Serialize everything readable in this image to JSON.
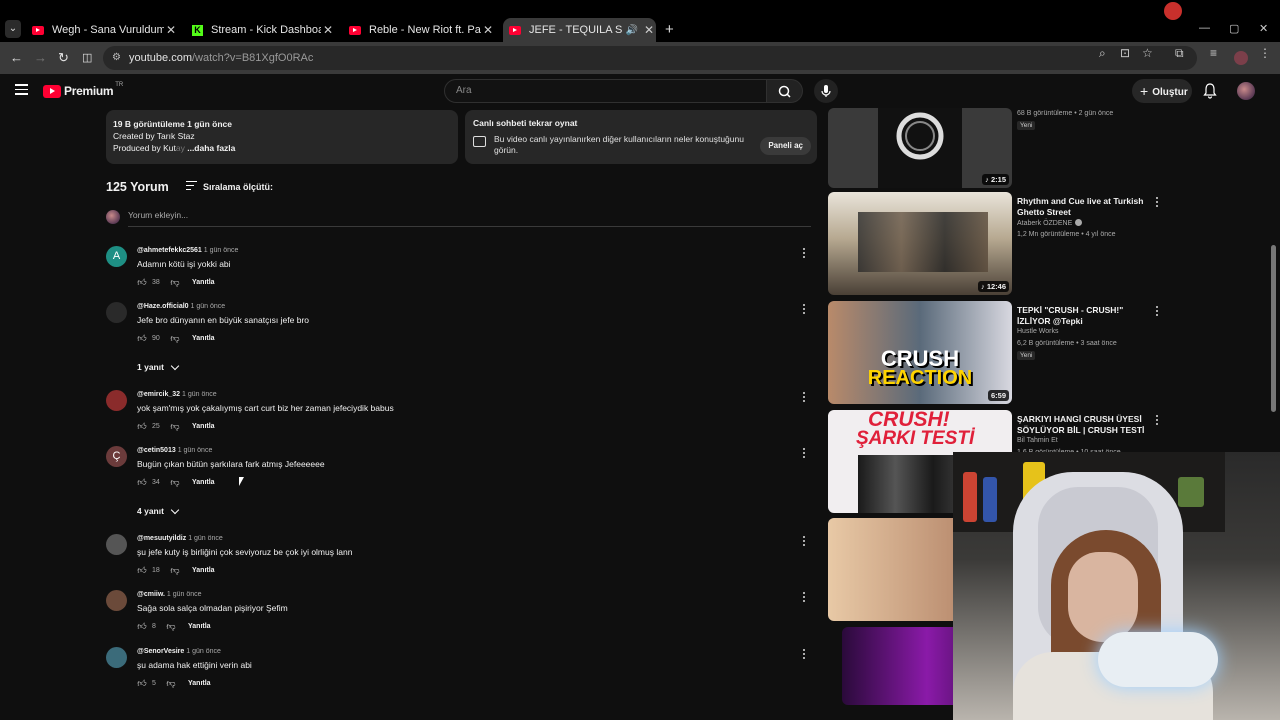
{
  "browser": {
    "tabs": [
      {
        "title": "Wegh - Sana Vuruldum / Uluba",
        "favicon": "youtube-icon"
      },
      {
        "title": "Stream - Kick Dashboard",
        "favicon": "kick-icon"
      },
      {
        "title": "Reble - New Riot ft. Parimal Sha",
        "favicon": "youtube-icon"
      },
      {
        "title": "JEFE - TEQUILA SUNRISE - Y",
        "favicon": "youtube-icon",
        "active": true
      }
    ],
    "url_host": "youtube.com",
    "url_path": "/watch?v=B81XgfO0RAc"
  },
  "yt": {
    "logo_word": "Premium",
    "logo_region": "TR",
    "search_placeholder": "Ara",
    "create_label": "Oluştur"
  },
  "description": {
    "stats": "19 B görüntüleme  1 gün önce",
    "line2": "Created by Tarık Staz",
    "line3_prefix": "Produced by Kut",
    "line3_fade": "ay",
    "more": "...daha fazla"
  },
  "chat_replay": {
    "title": "Canlı sohbeti tekrar oynat",
    "text": "Bu video canlı yayınlanırken diğer kullanıcıların neler konuştuğunu görün.",
    "button": "Paneli aç"
  },
  "comments_header": {
    "count": "125 Yorum",
    "sort_label": "Sıralama ölçütü:",
    "add_placeholder": "Yorum ekleyin..."
  },
  "comments": [
    {
      "user": "@ahmetefekkc2561",
      "time": "1 gün önce",
      "text": "Adamın kötü işi yokki abi",
      "likes": "38",
      "avatar_letter": "A",
      "avatar_color": "#1e8f84",
      "reply_label": "Yanıtla"
    },
    {
      "user": "@Haze.official0",
      "time": "1 gün önce",
      "text": "Jefe bro dünyanın en büyük sanatçısı jefe bro",
      "likes": "90",
      "avatar_letter": "",
      "avatar_color": "#2a2a2a",
      "reply_label": "Yanıtla",
      "replies": "1 yanıt"
    },
    {
      "user": "@emircik_32",
      "time": "1 gün önce",
      "text": "yok şam'mış yok çakalıymış cart curt biz her zaman jefeciydik babus",
      "likes": "25",
      "avatar_letter": "",
      "avatar_color": "#8a2b2b",
      "reply_label": "Yanıtla"
    },
    {
      "user": "@cetin5013",
      "time": "1 gün önce",
      "text": "Bugün çıkan bütün şarkılara fark atmış Jefeeeeee",
      "likes": "34",
      "avatar_letter": "Ç",
      "avatar_color": "#6b3b3b",
      "reply_label": "Yanıtla",
      "replies": "4 yanıt"
    },
    {
      "user": "@mesuutyildiz",
      "time": "1 gün önce",
      "text": "şu jefe kuty iş birliğini çok seviyoruz be çok iyi olmuş lann",
      "likes": "18",
      "avatar_letter": "",
      "avatar_color": "#555",
      "reply_label": "Yanıtla"
    },
    {
      "user": "@cmiiw.",
      "time": "1 gün önce",
      "text": "Sağa sola salça olmadan pişiriyor Şefim",
      "likes": "8",
      "avatar_letter": "",
      "avatar_color": "#6b4a3a",
      "reply_label": "Yanıtla"
    },
    {
      "user": "@SenorVesire",
      "time": "1 gün önce",
      "text": "şu adama hak ettiğini verin abi",
      "likes": "5",
      "avatar_letter": "",
      "avatar_color": "#3b6b7a",
      "reply_label": "Yanıtla"
    }
  ],
  "recommendations": [
    {
      "title": "",
      "channel": "",
      "meta": "68 B görüntüleme • 2 gün önce",
      "badge": "Yeni",
      "duration": "2:15",
      "music": true
    },
    {
      "title": "Rhythm and Cue live at Turkish Ghetto Street",
      "channel": "Ataberk ÖZDENE",
      "meta": "1,2 Mn görüntüleme • 4 yıl önce",
      "badge": "",
      "duration": "12:46",
      "music": true
    },
    {
      "title": "TEPKİ \"CRUSH - CRUSH!\" İZLİYOR @Tepki",
      "channel": "Hustle Works",
      "meta": "6,2 B görüntüleme • 3 saat önce",
      "badge": "Yeni",
      "duration": "6:59",
      "music": false,
      "thumb_text_1": "CRUSH",
      "thumb_text_2": "REACTION"
    },
    {
      "title": "ŞARKIYI HANGİ CRUSH ÜYESİ SÖYLÜYOR BİL | CRUSH TESTİ",
      "channel": "Bil Tahmin Et",
      "meta": "1,6 B görüntüleme • 10 saat önce",
      "badge": "",
      "duration": "",
      "music": false,
      "thumb_text_1": "CRUSH!",
      "thumb_text_2": "ŞARKI TESTİ"
    }
  ],
  "colors": {
    "brand_red": "#ff0033",
    "background": "#0f0f0f",
    "panel": "#272727"
  }
}
